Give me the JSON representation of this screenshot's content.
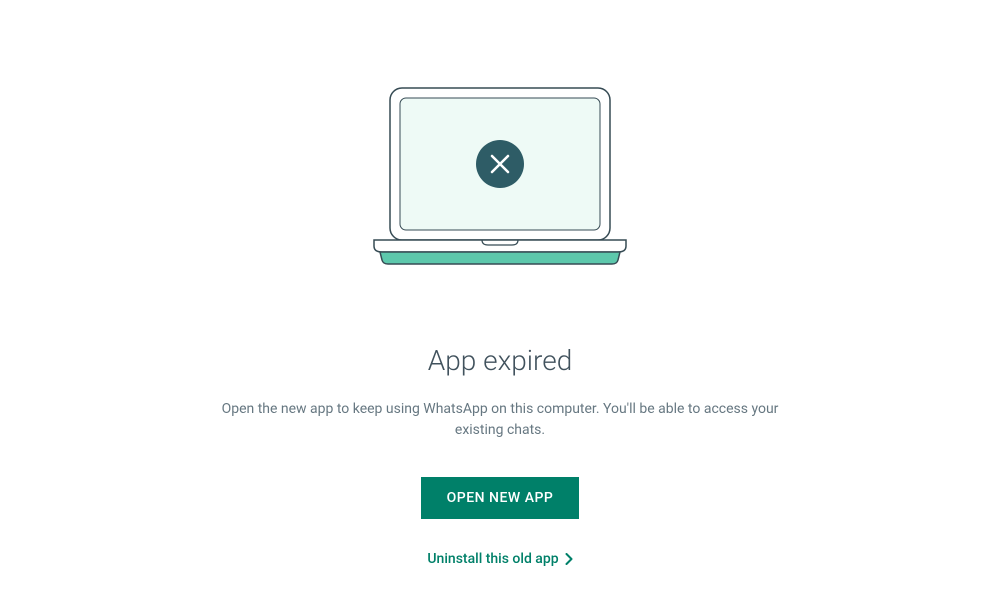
{
  "main": {
    "title": "App expired",
    "subtitle": "Open the new app to keep using WhatsApp on this computer. You'll be able to access your existing chats.",
    "primary_button_label": "OPEN NEW APP",
    "secondary_link_label": "Uninstall this old app"
  },
  "colors": {
    "accent": "#008069",
    "text_primary": "#41525d",
    "text_secondary": "#667781",
    "laptop_fill": "#eefaf6",
    "laptop_stroke": "#364b54",
    "laptop_base_accent": "#5dc8ac",
    "badge_fill": "#2e5c66"
  },
  "icons": {
    "badge": "close-icon",
    "link_arrow": "chevron-right-icon"
  }
}
